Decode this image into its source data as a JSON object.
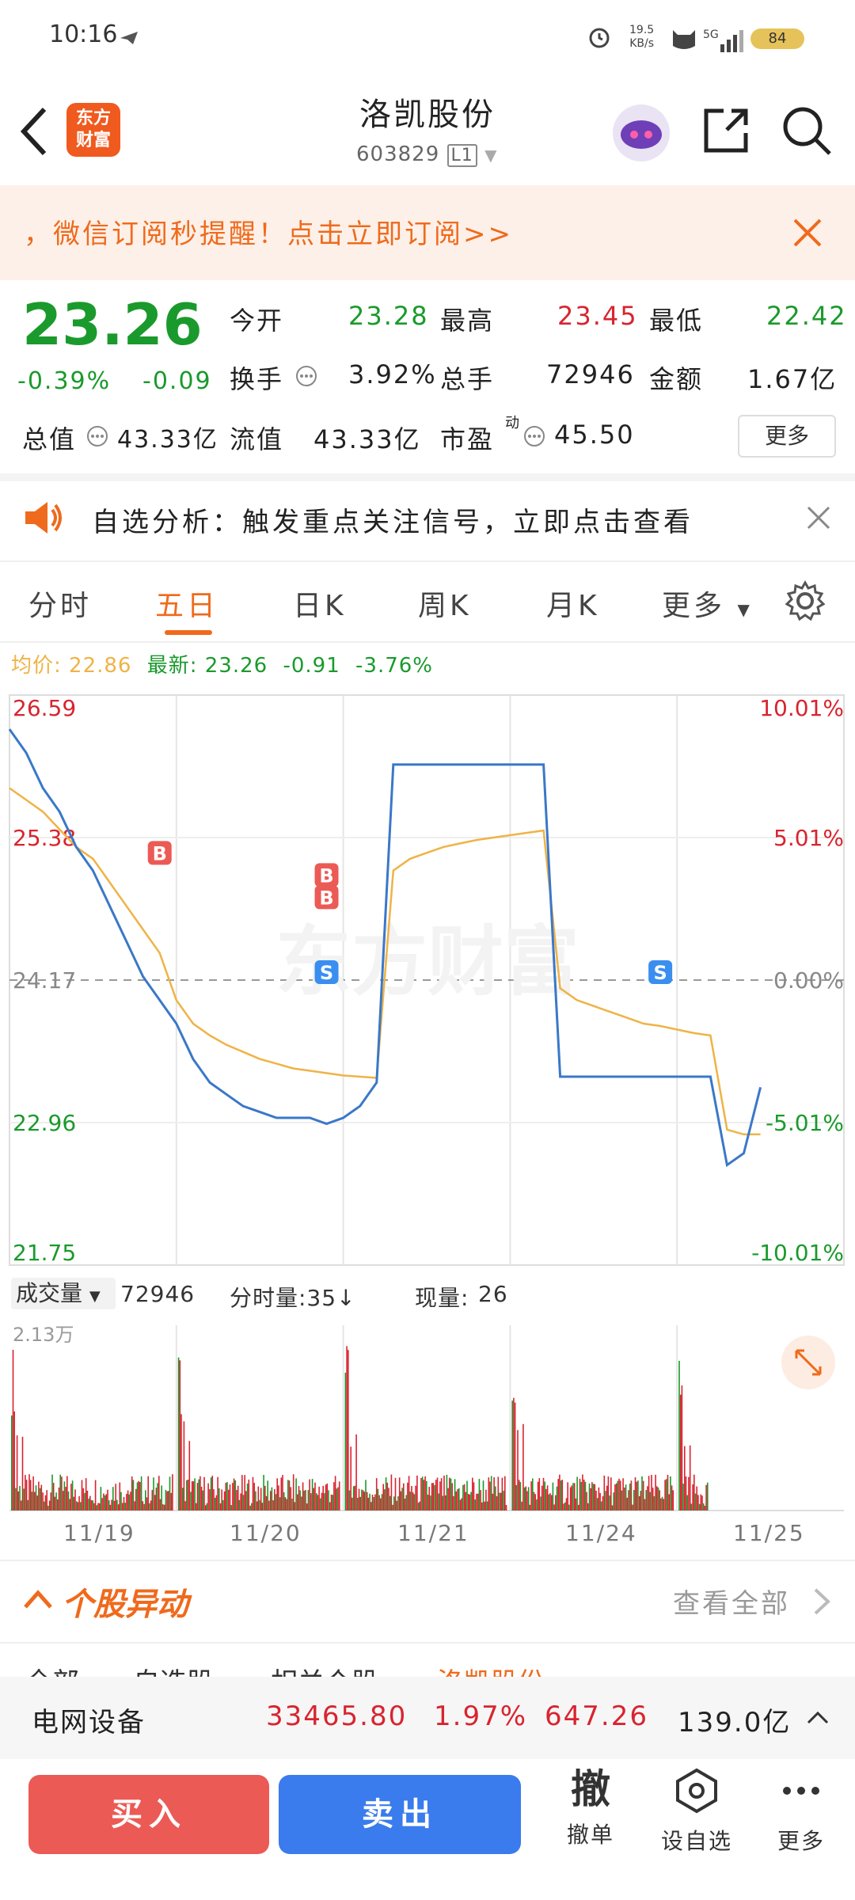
{
  "status_bar": {
    "time": "10:16",
    "net_rate_top": "19.5",
    "net_rate_bottom": "KB/s",
    "hd": "HD",
    "signal": "5G",
    "battery": "84"
  },
  "header": {
    "logo_line1": "东方",
    "logo_line2": "财富",
    "title": "洛凯股份",
    "code": "603829",
    "badge": "L1"
  },
  "banner": {
    "text": "，微信订阅秒提醒！点击立即订阅>>"
  },
  "quote": {
    "price": "23.26",
    "change_pct": "-0.39%",
    "change": "-0.09",
    "open_label": "今开",
    "open": "23.28",
    "high_label": "最高",
    "high": "23.45",
    "low_label": "最低",
    "low": "22.42",
    "turnover_label": "换手",
    "turnover": "3.92%",
    "volume_label": "总手",
    "volume": "72946",
    "amount_label": "金额",
    "amount": "1.67亿",
    "mktcap_label": "总值",
    "mktcap": "43.33亿",
    "float_label": "流值",
    "float": "43.33亿",
    "pe_label": "市盈",
    "pe_sup": "动",
    "pe": "45.50",
    "more": "更多"
  },
  "alert": {
    "text": "自选分析：触发重点关注信号，立即点击查看"
  },
  "tabs": [
    "分时",
    "五日",
    "日K",
    "周K",
    "月K",
    "更多"
  ],
  "avg_bar": {
    "avg_label": "均价:",
    "avg": "22.86",
    "latest_label": "最新:",
    "latest": "23.26",
    "chg": "-0.91",
    "pct": "-3.76%"
  },
  "chart_data": {
    "type": "line",
    "title": "",
    "days": [
      "11/19",
      "11/20",
      "11/21",
      "11/24",
      "11/25"
    ],
    "y_left_ticks": [
      "26.59",
      "25.38",
      "24.17",
      "22.96",
      "21.75"
    ],
    "y_right_ticks": [
      "10.01%",
      "5.01%",
      "0.00%",
      "-5.01%",
      "-10.01%"
    ],
    "ylim": [
      21.75,
      26.59
    ],
    "prev_close": 24.17,
    "series": [
      {
        "color": "#3a78c8",
        "values": [
          26.3,
          26.1,
          25.8,
          25.6,
          25.3,
          25.1,
          24.8,
          24.5,
          24.2,
          24.0,
          23.8,
          23.5,
          23.3,
          23.2,
          23.1,
          23.05,
          23.0,
          23.0,
          23.0,
          22.95,
          23.0,
          23.1,
          23.3,
          26.0,
          26.0,
          26.0,
          26.0,
          26.0,
          26.0,
          26.0,
          26.0,
          26.0,
          26.0,
          23.35,
          23.35,
          23.35,
          23.35,
          23.35,
          23.35,
          23.35,
          23.35,
          23.35,
          23.35,
          22.6,
          22.7,
          23.26
        ]
      },
      {
        "color": "#efb347",
        "values": [
          25.8,
          25.7,
          25.6,
          25.45,
          25.3,
          25.2,
          25.0,
          24.8,
          24.6,
          24.4,
          24.0,
          23.8,
          23.7,
          23.62,
          23.56,
          23.5,
          23.46,
          23.42,
          23.4,
          23.38,
          23.36,
          23.35,
          23.34,
          25.1,
          25.2,
          25.25,
          25.3,
          25.33,
          25.36,
          25.38,
          25.4,
          25.42,
          25.44,
          24.1,
          24.0,
          23.95,
          23.9,
          23.85,
          23.8,
          23.78,
          23.75,
          23.72,
          23.7,
          22.9,
          22.86,
          22.86
        ]
      }
    ],
    "markers": [
      {
        "type": "B",
        "day": "11/19"
      },
      {
        "type": "S",
        "day": "11/20"
      },
      {
        "type": "B",
        "day": "11/20"
      },
      {
        "type": "B",
        "day": "11/20"
      },
      {
        "type": "S",
        "day": "11/24"
      }
    ],
    "volume_max_label": "2.13万"
  },
  "volume_bar": {
    "select": "成交量",
    "total": "72946",
    "tick_label": "分时量:35↓",
    "now_label": "现量:",
    "now": "26"
  },
  "section": {
    "title": "个股异动",
    "link": "查看全部"
  },
  "section_tabs": [
    "全部",
    "自选股",
    "相关个股",
    "洛凯股份"
  ],
  "industry": {
    "name": "电网设备",
    "index": "33465.80",
    "pct": "1.97%",
    "chg": "647.26",
    "amount": "139.0亿"
  },
  "bottom": {
    "buy": "买入",
    "sell": "卖出",
    "cancel_big": "撤",
    "cancel": "撤单",
    "watch": "设自选",
    "more": "更多"
  },
  "colors": {
    "accent": "#ef6a1c",
    "up": "#d8242f",
    "down": "#1a9a2c",
    "buy": "#ec5a55",
    "sell": "#3a7bed"
  }
}
